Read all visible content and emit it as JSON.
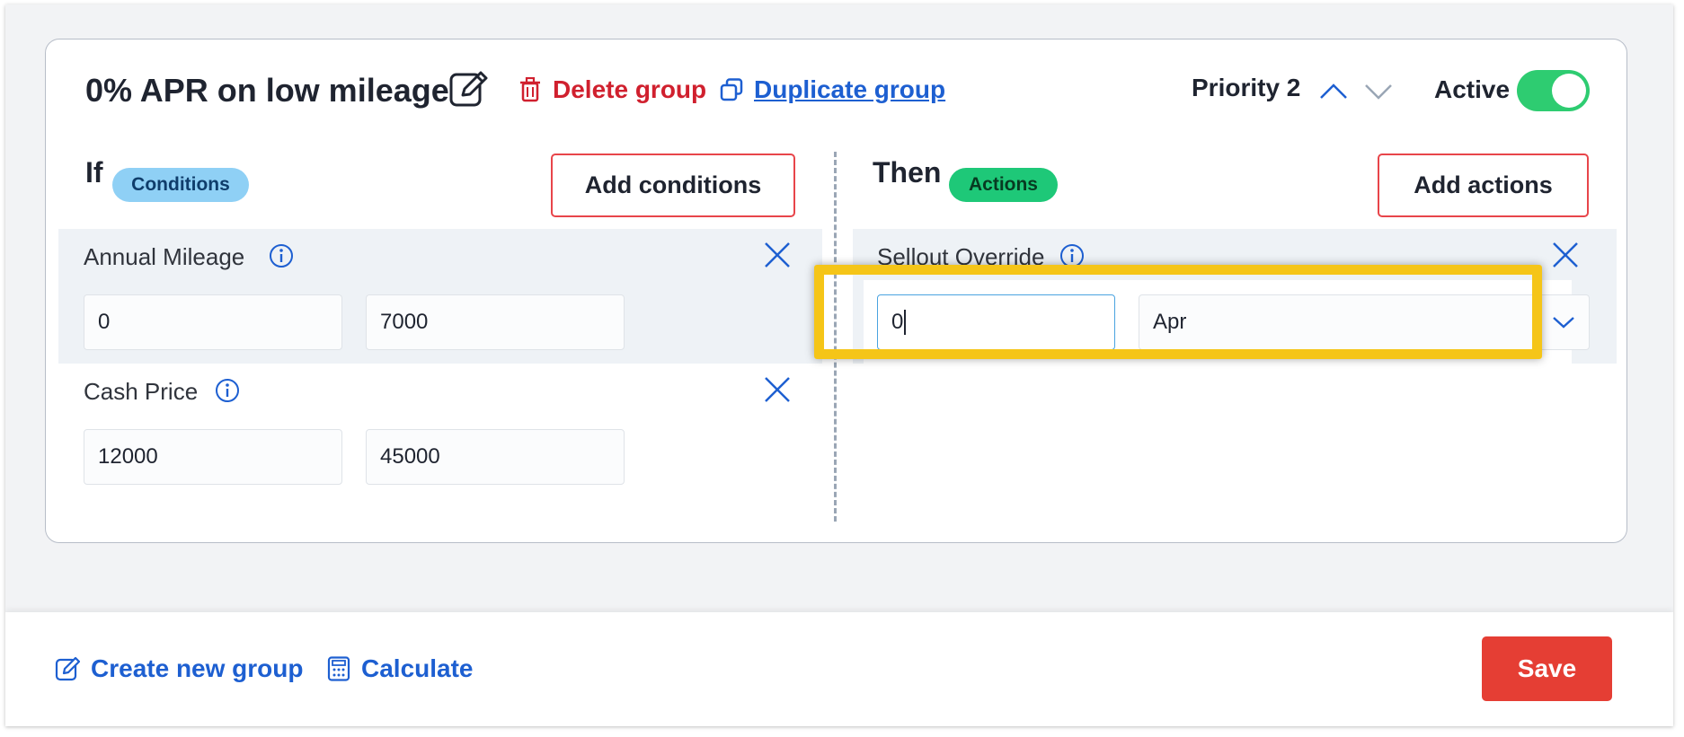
{
  "group": {
    "title": "0% APR on low mileage",
    "delete_label": "Delete group",
    "duplicate_label": "Duplicate group",
    "priority_label": "Priority 2",
    "active_label": "Active",
    "active": true
  },
  "conditions": {
    "heading": "If",
    "badge": "Conditions",
    "add_button": "Add conditions",
    "rows": [
      {
        "label": "Annual Mileage",
        "min": "0",
        "max": "7000"
      },
      {
        "label": "Cash Price",
        "min": "12000",
        "max": "45000"
      }
    ]
  },
  "actions": {
    "heading": "Then",
    "badge": "Actions",
    "add_button": "Add actions",
    "rows": [
      {
        "label": "Sellout Override",
        "value": "0",
        "select": "Apr"
      }
    ]
  },
  "footer": {
    "create_label": "Create new group",
    "calculate_label": "Calculate",
    "save_label": "Save"
  },
  "colors": {
    "accent_blue": "#1d5fd1",
    "danger_red": "#d0202e",
    "toggle_green": "#2ecc71",
    "highlight_yellow": "#f5c518"
  },
  "icons": [
    "edit-icon",
    "trash-icon",
    "duplicate-icon",
    "chevron-up-icon",
    "chevron-down-icon",
    "info-icon",
    "close-icon",
    "calculator-icon"
  ]
}
